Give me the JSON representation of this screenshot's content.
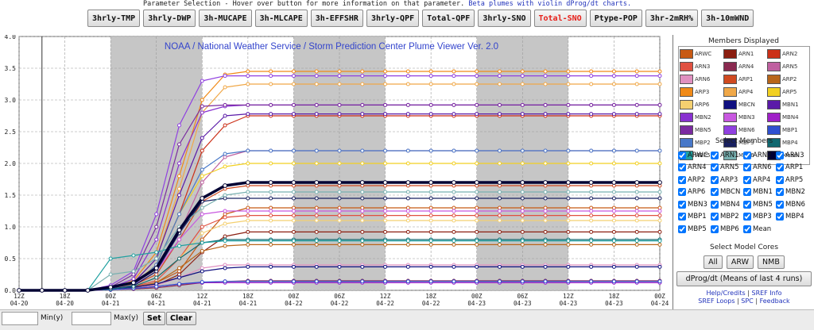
{
  "header": {
    "instruction": "Parameter Selection - Hover over button for more information on that parameter.",
    "beta_link": "Beta plumes with violin dProg/dt charts.",
    "buttons": [
      "3hrly-TMP",
      "3hrly-DWP",
      "3h-MUCAPE",
      "3h-MLCAPE",
      "3h-EFFSHR",
      "3hrly-QPF",
      "Total-QPF",
      "3hrly-SNO",
      "Total-SNO",
      "Ptype-POP",
      "3hr-2mRH%",
      "3h-10mWND"
    ],
    "active_button": "Total-SNO",
    "active_color": "#e8201a"
  },
  "chart_data": {
    "type": "line",
    "title": "NOAA / National Weather Service / Storm Prediction Center Plume Viewer Ver. 2.0",
    "ylim": [
      0,
      4.0
    ],
    "yticks": [
      "0.0",
      "0.5",
      "1.0",
      "1.5",
      "2.0",
      "2.5",
      "3.0",
      "3.5",
      "4.0"
    ],
    "xlim": [
      0,
      78
    ],
    "xticks": [
      {
        "x": 0,
        "hour": "12Z",
        "date": "04-20"
      },
      {
        "x": 6,
        "hour": "18Z",
        "date": "04-20"
      },
      {
        "x": 12,
        "hour": "00Z",
        "date": "04-21"
      },
      {
        "x": 18,
        "hour": "06Z",
        "date": "04-21"
      },
      {
        "x": 24,
        "hour": "12Z",
        "date": "04-21"
      },
      {
        "x": 30,
        "hour": "18Z",
        "date": "04-21"
      },
      {
        "x": 36,
        "hour": "00Z",
        "date": "04-22"
      },
      {
        "x": 42,
        "hour": "06Z",
        "date": "04-22"
      },
      {
        "x": 48,
        "hour": "12Z",
        "date": "04-22"
      },
      {
        "x": 54,
        "hour": "18Z",
        "date": "04-22"
      },
      {
        "x": 60,
        "hour": "00Z",
        "date": "04-23"
      },
      {
        "x": 66,
        "hour": "06Z",
        "date": "04-23"
      },
      {
        "x": 72,
        "hour": "12Z",
        "date": "04-23"
      },
      {
        "x": 78,
        "hour": "18Z",
        "date": "04-23"
      },
      {
        "x": 84,
        "hour": "00Z",
        "date": "04-24"
      }
    ],
    "night_bands": [
      [
        12,
        24
      ],
      [
        36,
        48
      ],
      [
        60,
        72
      ]
    ],
    "grid": true,
    "x_hours": [
      0,
      3,
      6,
      9,
      12,
      15,
      18,
      21,
      24,
      27,
      30,
      33,
      36,
      39,
      42,
      45,
      48,
      51,
      54,
      57,
      60,
      63,
      66,
      69,
      72,
      75,
      78,
      81,
      84
    ],
    "series": [
      {
        "name": "ARWC",
        "color": "#c85a14",
        "values": [
          0,
          0,
          0,
          0,
          0.02,
          0.05,
          0.12,
          0.3,
          0.8,
          1.2,
          1.3,
          1.3,
          1.3,
          1.3,
          1.3,
          1.3,
          1.3,
          1.3,
          1.3,
          1.3,
          1.3,
          1.3,
          1.3,
          1.3,
          1.3,
          1.3,
          1.3,
          1.3,
          1.3
        ]
      },
      {
        "name": "ARN1",
        "color": "#8b1e10",
        "values": [
          0,
          0,
          0,
          0,
          0.01,
          0.03,
          0.08,
          0.25,
          0.6,
          0.85,
          0.92,
          0.92,
          0.92,
          0.92,
          0.92,
          0.92,
          0.92,
          0.92,
          0.92,
          0.92,
          0.92,
          0.92,
          0.92,
          0.92,
          0.92,
          0.92,
          0.92,
          0.92,
          0.92
        ]
      },
      {
        "name": "ARN2",
        "color": "#cc3018",
        "values": [
          0,
          0,
          0,
          0,
          0.03,
          0.1,
          0.4,
          1.2,
          2.2,
          2.6,
          2.75,
          2.75,
          2.75,
          2.75,
          2.75,
          2.75,
          2.75,
          2.75,
          2.75,
          2.75,
          2.75,
          2.75,
          2.75,
          2.75,
          2.75,
          2.75,
          2.75,
          2.75,
          2.75
        ]
      },
      {
        "name": "ARN3",
        "color": "#e05040",
        "values": [
          0,
          0,
          0,
          0,
          0.02,
          0.06,
          0.15,
          0.5,
          1.0,
          1.15,
          1.18,
          1.18,
          1.18,
          1.18,
          1.18,
          1.18,
          1.18,
          1.18,
          1.18,
          1.18,
          1.18,
          1.18,
          1.18,
          1.18,
          1.18,
          1.18,
          1.18,
          1.18,
          1.18
        ]
      },
      {
        "name": "ARN4",
        "color": "#8a2a50",
        "values": [
          0,
          0,
          0,
          0,
          0.01,
          0.02,
          0.04,
          0.08,
          0.12,
          0.14,
          0.15,
          0.15,
          0.15,
          0.15,
          0.15,
          0.15,
          0.15,
          0.15,
          0.15,
          0.15,
          0.15,
          0.15,
          0.15,
          0.15,
          0.15,
          0.15,
          0.15,
          0.15,
          0.15
        ]
      },
      {
        "name": "ARN5",
        "color": "#c060a0",
        "values": [
          0,
          0,
          0,
          0,
          0.02,
          0.08,
          0.3,
          0.9,
          1.7,
          2.1,
          2.2,
          2.2,
          2.2,
          2.2,
          2.2,
          2.2,
          2.2,
          2.2,
          2.2,
          2.2,
          2.2,
          2.2,
          2.2,
          2.2,
          2.2,
          2.2,
          2.2,
          2.2,
          2.2
        ]
      },
      {
        "name": "ARN6",
        "color": "#e090c0",
        "values": [
          0,
          0,
          0,
          0,
          0.01,
          0.03,
          0.08,
          0.2,
          0.35,
          0.4,
          0.4,
          0.4,
          0.4,
          0.4,
          0.4,
          0.4,
          0.4,
          0.4,
          0.4,
          0.4,
          0.4,
          0.4,
          0.4,
          0.4,
          0.4,
          0.4,
          0.4,
          0.4,
          0.4
        ]
      },
      {
        "name": "ARP1",
        "color": "#d04a20",
        "values": [
          0,
          0,
          0,
          0,
          0.02,
          0.08,
          0.25,
          0.8,
          1.4,
          1.6,
          1.65,
          1.65,
          1.65,
          1.65,
          1.65,
          1.65,
          1.65,
          1.65,
          1.65,
          1.65,
          1.65,
          1.65,
          1.65,
          1.65,
          1.65,
          1.65,
          1.65,
          1.65,
          1.65
        ]
      },
      {
        "name": "ARP2",
        "color": "#b8661a",
        "values": [
          0,
          0,
          0,
          0,
          0.01,
          0.04,
          0.12,
          0.35,
          0.62,
          0.7,
          0.72,
          0.72,
          0.72,
          0.72,
          0.72,
          0.72,
          0.72,
          0.72,
          0.72,
          0.72,
          0.72,
          0.72,
          0.72,
          0.72,
          0.72,
          0.72,
          0.72,
          0.72,
          0.72
        ]
      },
      {
        "name": "ARP3",
        "color": "#f08a18",
        "values": [
          0,
          0,
          0,
          0,
          0.04,
          0.15,
          0.6,
          1.8,
          3.0,
          3.4,
          3.45,
          3.45,
          3.45,
          3.45,
          3.45,
          3.45,
          3.45,
          3.45,
          3.45,
          3.45,
          3.45,
          3.45,
          3.45,
          3.45,
          3.45,
          3.45,
          3.45,
          3.45,
          3.45
        ]
      },
      {
        "name": "ARP4",
        "color": "#f0a848",
        "values": [
          0,
          0,
          0,
          0,
          0.03,
          0.12,
          0.5,
          1.6,
          2.8,
          3.2,
          3.25,
          3.25,
          3.25,
          3.25,
          3.25,
          3.25,
          3.25,
          3.25,
          3.25,
          3.25,
          3.25,
          3.25,
          3.25,
          3.25,
          3.25,
          3.25,
          3.25,
          3.25,
          3.25
        ]
      },
      {
        "name": "ARP5",
        "color": "#f2d020",
        "values": [
          0,
          0,
          0,
          0,
          0.03,
          0.1,
          0.4,
          1.2,
          1.8,
          1.95,
          2.0,
          2.0,
          2.0,
          2.0,
          2.0,
          2.0,
          2.0,
          2.0,
          2.0,
          2.0,
          2.0,
          2.0,
          2.0,
          2.0,
          2.0,
          2.0,
          2.0,
          2.0,
          2.0
        ]
      },
      {
        "name": "ARP6",
        "color": "#f4d070",
        "values": [
          0,
          0,
          0,
          0,
          0.02,
          0.06,
          0.2,
          0.5,
          0.9,
          1.05,
          1.1,
          1.1,
          1.1,
          1.1,
          1.1,
          1.1,
          1.1,
          1.1,
          1.1,
          1.1,
          1.1,
          1.1,
          1.1,
          1.1,
          1.1,
          1.1,
          1.1,
          1.1,
          1.1
        ]
      },
      {
        "name": "MBCN",
        "color": "#101080",
        "values": [
          0,
          0,
          0,
          0,
          0.02,
          0.05,
          0.1,
          0.2,
          0.3,
          0.35,
          0.37,
          0.37,
          0.37,
          0.37,
          0.37,
          0.37,
          0.37,
          0.37,
          0.37,
          0.37,
          0.37,
          0.37,
          0.37,
          0.37,
          0.37,
          0.37,
          0.37,
          0.37,
          0.37
        ]
      },
      {
        "name": "MBN1",
        "color": "#5a1aa8",
        "values": [
          0,
          0,
          0,
          0,
          0.03,
          0.12,
          0.5,
          1.5,
          2.4,
          2.75,
          2.78,
          2.78,
          2.78,
          2.78,
          2.78,
          2.78,
          2.78,
          2.78,
          2.78,
          2.78,
          2.78,
          2.78,
          2.78,
          2.78,
          2.78,
          2.78,
          2.78,
          2.78,
          2.78
        ]
      },
      {
        "name": "MBN2",
        "color": "#8830d0",
        "values": [
          0,
          0,
          0,
          0,
          0.04,
          0.18,
          0.8,
          2.0,
          2.8,
          2.9,
          2.92,
          2.92,
          2.92,
          2.92,
          2.92,
          2.92,
          2.92,
          2.92,
          2.92,
          2.92,
          2.92,
          2.92,
          2.92,
          2.92,
          2.92,
          2.92,
          2.92,
          2.92,
          2.92
        ]
      },
      {
        "name": "MBN3",
        "color": "#c858e0",
        "values": [
          0,
          0,
          0,
          0,
          0.02,
          0.08,
          0.3,
          0.8,
          1.2,
          1.25,
          1.25,
          1.25,
          1.25,
          1.25,
          1.25,
          1.25,
          1.25,
          1.25,
          1.25,
          1.25,
          1.25,
          1.25,
          1.25,
          1.25,
          1.25,
          1.25,
          1.25,
          1.25,
          1.25
        ]
      },
      {
        "name": "MBN4",
        "color": "#a020c8",
        "values": [
          0,
          0,
          0,
          0,
          0.01,
          0.03,
          0.06,
          0.1,
          0.12,
          0.12,
          0.12,
          0.12,
          0.12,
          0.12,
          0.12,
          0.12,
          0.12,
          0.12,
          0.12,
          0.12,
          0.12,
          0.12,
          0.12,
          0.12,
          0.12,
          0.12,
          0.12,
          0.12,
          0.12
        ]
      },
      {
        "name": "MBN5",
        "color": "#7a2aa0",
        "values": [
          0,
          0,
          0,
          0,
          0.05,
          0.25,
          1.0,
          2.3,
          2.9,
          2.92,
          2.92,
          2.92,
          2.92,
          2.92,
          2.92,
          2.92,
          2.92,
          2.92,
          2.92,
          2.92,
          2.92,
          2.92,
          2.92,
          2.92,
          2.92,
          2.92,
          2.92,
          2.92,
          2.92
        ]
      },
      {
        "name": "MBN6",
        "color": "#9040e0",
        "values": [
          0,
          0,
          0,
          0,
          0.08,
          0.3,
          1.2,
          2.6,
          3.3,
          3.38,
          3.38,
          3.38,
          3.38,
          3.38,
          3.38,
          3.38,
          3.38,
          3.38,
          3.38,
          3.38,
          3.38,
          3.38,
          3.38,
          3.38,
          3.38,
          3.38,
          3.38,
          3.38,
          3.38
        ]
      },
      {
        "name": "MBP1",
        "color": "#3050d0",
        "values": [
          0,
          0,
          0,
          0,
          0.01,
          0.03,
          0.06,
          0.1,
          0.13,
          0.14,
          0.14,
          0.14,
          0.14,
          0.14,
          0.14,
          0.14,
          0.14,
          0.14,
          0.14,
          0.14,
          0.14,
          0.14,
          0.14,
          0.14,
          0.14,
          0.14,
          0.14,
          0.14,
          0.14
        ]
      },
      {
        "name": "MBP2",
        "color": "#4878c8",
        "values": [
          0,
          0,
          0,
          0,
          0.02,
          0.08,
          0.4,
          1.2,
          1.9,
          2.15,
          2.2,
          2.2,
          2.2,
          2.2,
          2.2,
          2.2,
          2.2,
          2.2,
          2.2,
          2.2,
          2.2,
          2.2,
          2.2,
          2.2,
          2.2,
          2.2,
          2.2,
          2.2,
          2.2
        ]
      },
      {
        "name": "MBP3",
        "color": "#182060",
        "values": [
          0,
          0,
          0,
          0,
          0.02,
          0.07,
          0.3,
          0.9,
          1.4,
          1.45,
          1.45,
          1.45,
          1.45,
          1.45,
          1.45,
          1.45,
          1.45,
          1.45,
          1.45,
          1.45,
          1.45,
          1.45,
          1.45,
          1.45,
          1.45,
          1.45,
          1.45,
          1.45,
          1.45
        ]
      },
      {
        "name": "MBP4",
        "color": "#106870",
        "values": [
          0,
          0,
          0,
          0,
          0.02,
          0.06,
          0.2,
          0.5,
          0.75,
          0.8,
          0.8,
          0.8,
          0.8,
          0.8,
          0.8,
          0.8,
          0.8,
          0.8,
          0.8,
          0.8,
          0.8,
          0.8,
          0.8,
          0.8,
          0.8,
          0.8,
          0.8,
          0.8,
          0.8
        ]
      },
      {
        "name": "MBP5",
        "color": "#20a0a0",
        "values": [
          0,
          0,
          0,
          0,
          0.5,
          0.55,
          0.6,
          0.7,
          0.75,
          0.78,
          0.78,
          0.78,
          0.78,
          0.78,
          0.78,
          0.78,
          0.78,
          0.78,
          0.78,
          0.78,
          0.78,
          0.78,
          0.78,
          0.78,
          0.78,
          0.78,
          0.78,
          0.78,
          0.78
        ]
      },
      {
        "name": "MBP6",
        "color": "#78b0b0",
        "values": [
          0,
          0,
          0,
          0,
          0.25,
          0.3,
          0.5,
          1.0,
          1.3,
          1.5,
          1.55,
          1.55,
          1.55,
          1.55,
          1.55,
          1.55,
          1.55,
          1.55,
          1.55,
          1.55,
          1.55,
          1.55,
          1.55,
          1.55,
          1.55,
          1.55,
          1.55,
          1.55,
          1.55
        ]
      },
      {
        "name": "Mean",
        "color": "#000033",
        "values": [
          0,
          0,
          0,
          0,
          0.05,
          0.12,
          0.35,
          0.95,
          1.45,
          1.65,
          1.7,
          1.7,
          1.7,
          1.7,
          1.7,
          1.7,
          1.7,
          1.7,
          1.7,
          1.7,
          1.7,
          1.7,
          1.7,
          1.7,
          1.7,
          1.7,
          1.7,
          1.7,
          1.7
        ]
      }
    ]
  },
  "sidebar": {
    "members_displayed": "Members Displayed",
    "select_members": "Select Members",
    "select_cores": "Select Model Cores",
    "core_buttons": [
      "All",
      "ARW",
      "NMB"
    ],
    "dprog_button": "dProg/dt (Means of last 4 runs)",
    "links": {
      "help": "Help/Credits",
      "sref_info": "SREF Info",
      "sref_loops": "SREF Loops",
      "spc": "SPC",
      "feedback": "Feedback"
    }
  },
  "bottom": {
    "min_label": "Min(y)",
    "max_label": "Max(y)",
    "set_label": "Set",
    "clear_label": "Clear"
  }
}
